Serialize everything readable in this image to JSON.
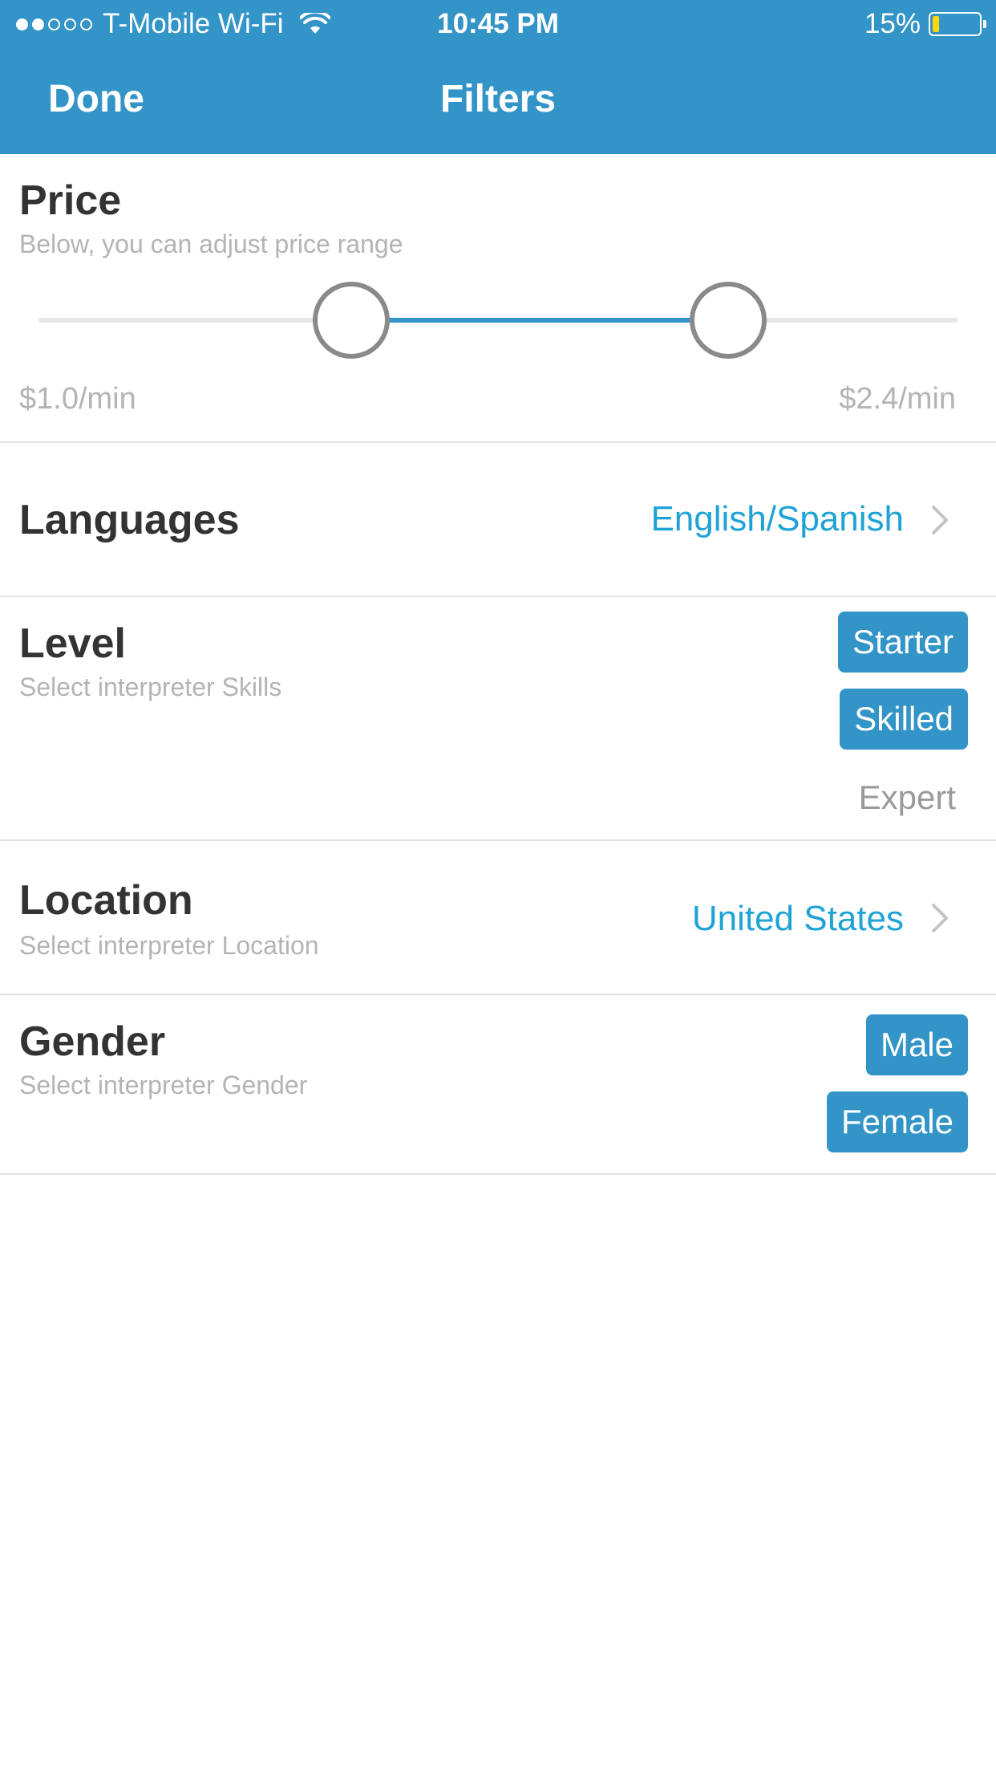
{
  "status_bar": {
    "signal_dots_filled": 2,
    "signal_dots_total": 5,
    "carrier": "T-Mobile Wi-Fi",
    "time": "10:45 PM",
    "battery": "15%",
    "battery_level": 0.15,
    "battery_color": "#ffd60a"
  },
  "nav": {
    "done_label": "Done",
    "title": "Filters",
    "background_color": "#3394c8"
  },
  "price": {
    "title": "Price",
    "subtitle": "Below, you can adjust price range",
    "min_label": "$1.0/min",
    "max_label": "$2.4/min",
    "range_low_fraction": 0.34,
    "range_high_fraction": 0.75
  },
  "languages": {
    "title": "Languages",
    "value": "English/Spanish",
    "icon": "chevron-right-icon"
  },
  "level": {
    "title": "Level",
    "subtitle": "Select interpreter Skills",
    "options": [
      {
        "label": "Starter",
        "selected": true
      },
      {
        "label": "Skilled",
        "selected": true
      },
      {
        "label": "Expert",
        "selected": false
      }
    ]
  },
  "location": {
    "title": "Location",
    "subtitle": "Select interpreter Location",
    "value": "United States",
    "icon": "chevron-right-icon"
  },
  "gender": {
    "title": "Gender",
    "subtitle": "Select interpreter Gender",
    "options": [
      {
        "label": "Male",
        "selected": true
      },
      {
        "label": "Female",
        "selected": true
      }
    ]
  },
  "colors": {
    "accent": "#3394c8",
    "link": "#1fa3d6",
    "title_text": "#333333",
    "muted_text": "#b4b4b4"
  }
}
